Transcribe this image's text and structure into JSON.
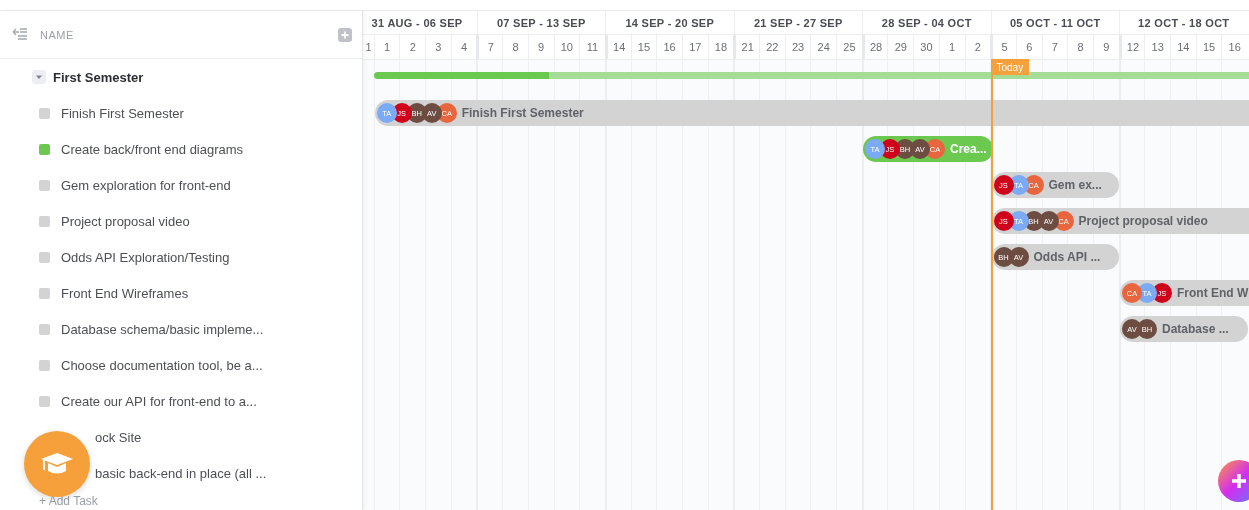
{
  "sidebar": {
    "header": "NAME",
    "group": {
      "name": "First Semester",
      "expanded": true
    },
    "tasks": [
      {
        "name": "Finish First Semester",
        "color": "#d3d3d3",
        "covered": false
      },
      {
        "name": "Create back/front end diagrams",
        "color": "#6bc950",
        "covered": false
      },
      {
        "name": "Gem exploration for front-end",
        "color": "#d3d3d3",
        "covered": false
      },
      {
        "name": "Project proposal video",
        "color": "#d3d3d3",
        "covered": false
      },
      {
        "name": "Odds API Exploration/Testing",
        "color": "#d3d3d3",
        "covered": false
      },
      {
        "name": "Front End Wireframes",
        "color": "#d3d3d3",
        "covered": false
      },
      {
        "name": "Database schema/basic impleme...",
        "color": "#d3d3d3",
        "covered": false
      },
      {
        "name": "Choose documentation tool, be a...",
        "color": "#d3d3d3",
        "covered": false
      },
      {
        "name": "Create our API for front-end to a...",
        "color": "#d3d3d3",
        "covered": false
      },
      {
        "name": "ock Site",
        "covered": true
      },
      {
        "name": "basic back-end in place (all ...",
        "covered": true
      }
    ],
    "add_task": "+ Add Task"
  },
  "timeline": {
    "weeks": [
      {
        "label": "31 AUG - 06 SEP",
        "days": [
          "1",
          "1",
          "2",
          "3",
          "4"
        ]
      },
      {
        "label": "07 SEP - 13 SEP",
        "days": [
          "7",
          "8",
          "9",
          "10",
          "11"
        ]
      },
      {
        "label": "14 SEP - 20 SEP",
        "days": [
          "14",
          "15",
          "16",
          "17",
          "18"
        ]
      },
      {
        "label": "21 SEP - 27 SEP",
        "days": [
          "21",
          "22",
          "23",
          "24",
          "25"
        ]
      },
      {
        "label": "28 SEP - 04 OCT",
        "days": [
          "28",
          "29",
          "30",
          "1",
          "2"
        ]
      },
      {
        "label": "05 OCT - 11 OCT",
        "days": [
          "5",
          "6",
          "7",
          "8",
          "9"
        ]
      },
      {
        "label": "12 OCT - 18 OCT",
        "days": [
          "12",
          "13",
          "14",
          "15",
          "16"
        ]
      }
    ],
    "today": {
      "label": "Today"
    },
    "group_bar": {
      "level": 0.2
    },
    "bars": [
      {
        "label": "Finish First Semester",
        "color": "#d3d3d3",
        "avatars": [
          {
            "initials": "TA",
            "color": "#7baaf7"
          },
          {
            "initials": "JS",
            "color": "#d0021b"
          },
          {
            "initials": "BH",
            "color": "#6d4c41"
          },
          {
            "initials": "AV",
            "color": "#6d4c41"
          },
          {
            "initials": "CA",
            "color": "#e8663d"
          }
        ]
      },
      {
        "label": "Crea...",
        "color": "#6bc950",
        "avatars": [
          {
            "initials": "TA",
            "color": "#7baaf7"
          },
          {
            "initials": "JS",
            "color": "#d0021b"
          },
          {
            "initials": "BH",
            "color": "#6d4c41"
          },
          {
            "initials": "AV",
            "color": "#6d4c41"
          },
          {
            "initials": "CA",
            "color": "#e8663d"
          }
        ]
      },
      {
        "label": "Gem ex...",
        "color": "#d3d3d3",
        "avatars": [
          {
            "initials": "JS",
            "color": "#d0021b"
          },
          {
            "initials": "TA",
            "color": "#7baaf7"
          },
          {
            "initials": "CA",
            "color": "#e8663d"
          }
        ]
      },
      {
        "label": "Project proposal video",
        "color": "#d3d3d3",
        "avatars": [
          {
            "initials": "JS",
            "color": "#d0021b"
          },
          {
            "initials": "TA",
            "color": "#7baaf7"
          },
          {
            "initials": "BH",
            "color": "#6d4c41"
          },
          {
            "initials": "AV",
            "color": "#6d4c41"
          },
          {
            "initials": "CA",
            "color": "#e8663d"
          }
        ]
      },
      {
        "label": "Odds API ...",
        "color": "#d3d3d3",
        "avatars": [
          {
            "initials": "BH",
            "color": "#6d4c41"
          },
          {
            "initials": "AV",
            "color": "#6d4c41"
          }
        ]
      },
      {
        "label": "Front End W",
        "color": "#d3d3d3",
        "avatars": [
          {
            "initials": "CA",
            "color": "#e8663d"
          },
          {
            "initials": "TA",
            "color": "#7baaf7"
          },
          {
            "initials": "JS",
            "color": "#d0021b"
          }
        ]
      },
      {
        "label": "Database ...",
        "color": "#d3d3d3",
        "avatars": [
          {
            "initials": "AV",
            "color": "#6d4c41"
          },
          {
            "initials": "BH",
            "color": "#6d4c41"
          }
        ]
      }
    ]
  }
}
